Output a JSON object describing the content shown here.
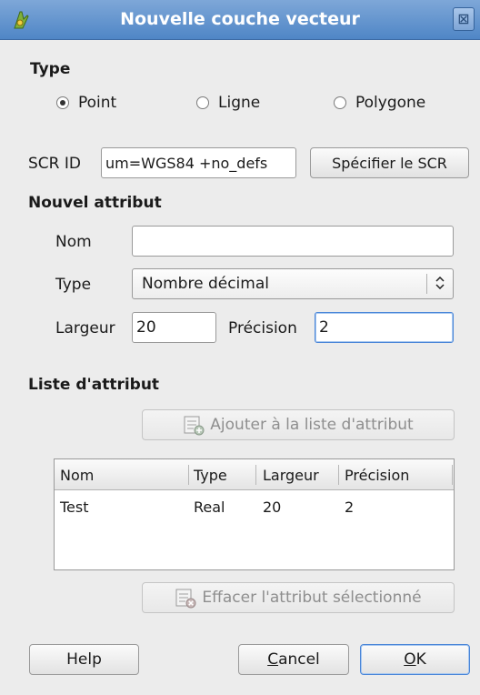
{
  "window": {
    "title": "Nouvelle couche vecteur",
    "close_glyph": "⊠"
  },
  "type_section": {
    "heading": "Type",
    "options": [
      {
        "label": "Point",
        "checked": true
      },
      {
        "label": "Ligne",
        "checked": false
      },
      {
        "label": "Polygone",
        "checked": false
      }
    ]
  },
  "crs": {
    "label": "SCR ID",
    "value": "um=WGS84 +no_defs",
    "button": "Spécifier le SCR"
  },
  "new_attribute": {
    "heading": "Nouvel attribut",
    "name_label": "Nom",
    "name_value": "",
    "type_label": "Type",
    "type_value": "Nombre décimal",
    "width_label": "Largeur",
    "width_value": "20",
    "precision_label": "Précision",
    "precision_value": "2"
  },
  "attribute_list": {
    "heading": "Liste d'attribut",
    "add_button": "Ajouter à la liste d'attribut",
    "columns": [
      "Nom",
      "Type",
      "Largeur",
      "Précision"
    ],
    "rows": [
      [
        "Test",
        "Real",
        "20",
        "2"
      ]
    ],
    "remove_button": "Effacer l'attribut sélectionné"
  },
  "footer": {
    "help": "Help",
    "cancel_mnemonic": "C",
    "cancel_rest": "ancel",
    "ok_mnemonic": "O",
    "ok_rest": "K"
  },
  "colors": {
    "titlebar": "#4f86c6",
    "focus": "#4a86d8",
    "background": "#ececec"
  },
  "icons": [
    "qgis-logo-icon",
    "close-icon",
    "radio-icon",
    "spinner-icon",
    "add-attribute-icon",
    "remove-attribute-icon"
  ]
}
